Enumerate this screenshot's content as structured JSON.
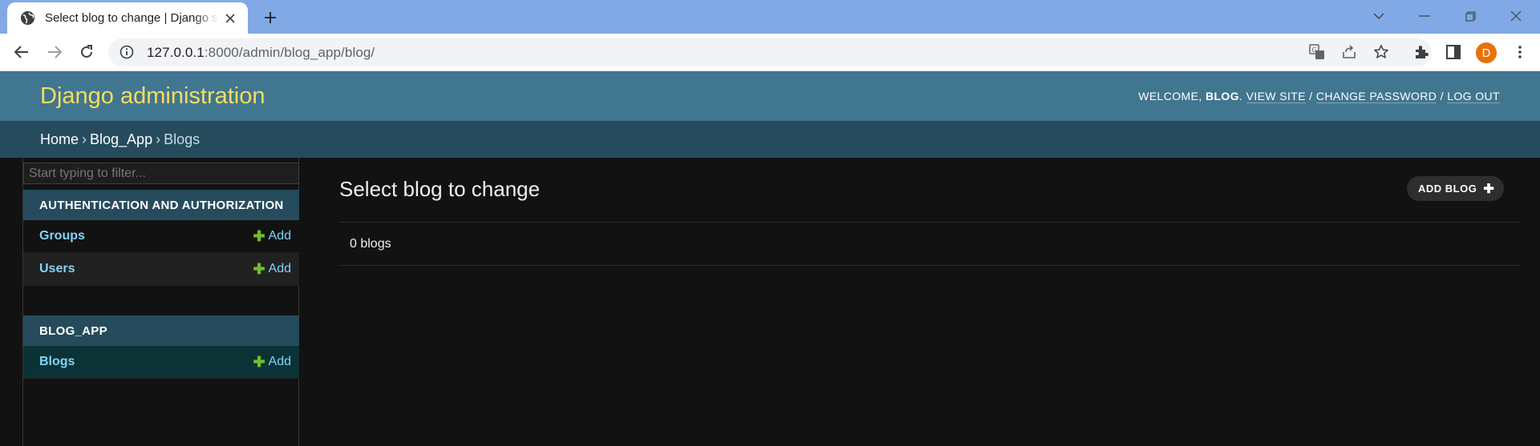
{
  "browser": {
    "tab_title": "Select blog to change | Django site admin",
    "url_host": "127.0.0.1",
    "url_rest": ":8000/admin/blog_app/blog/",
    "avatar_letter": "D",
    "icons": [
      "globe-icon",
      "close-icon",
      "plus-icon",
      "chevron-down-icon",
      "minimize-icon",
      "restore-icon",
      "window-close-icon",
      "back-icon",
      "forward-icon",
      "reload-icon",
      "info-icon",
      "translate-icon",
      "share-icon",
      "star-icon",
      "extensions-icon",
      "sidepanel-icon",
      "kebab-menu-icon"
    ]
  },
  "header": {
    "branding": "Django administration",
    "welcome": "WELCOME,",
    "username": "BLOG",
    "period": ".",
    "view_site": "VIEW SITE",
    "change_password": "CHANGE PASSWORD",
    "log_out": "LOG OUT",
    "sep": "/"
  },
  "breadcrumbs": {
    "home": "Home",
    "app": "Blog_App",
    "current": "Blogs",
    "sep": "›"
  },
  "sidebar": {
    "filter_placeholder": "Start typing to filter...",
    "modules": [
      {
        "caption": "AUTHENTICATION AND AUTHORIZATION",
        "rows": [
          {
            "model": "Groups",
            "add": "Add"
          },
          {
            "model": "Users",
            "add": "Add"
          }
        ]
      },
      {
        "caption": "BLOG_APP",
        "rows": [
          {
            "model": "Blogs",
            "add": "Add"
          }
        ]
      }
    ]
  },
  "content": {
    "title": "Select blog to change",
    "add_button": "ADD BLOG",
    "result_count": "0 blogs"
  },
  "colors": {
    "header_bg": "#417690",
    "breadcrumb_bg": "#264b5d",
    "branding": "#f5dd5d",
    "link": "#81d4fa",
    "add_plus": "#70bf2b",
    "page_bg": "#121212"
  }
}
